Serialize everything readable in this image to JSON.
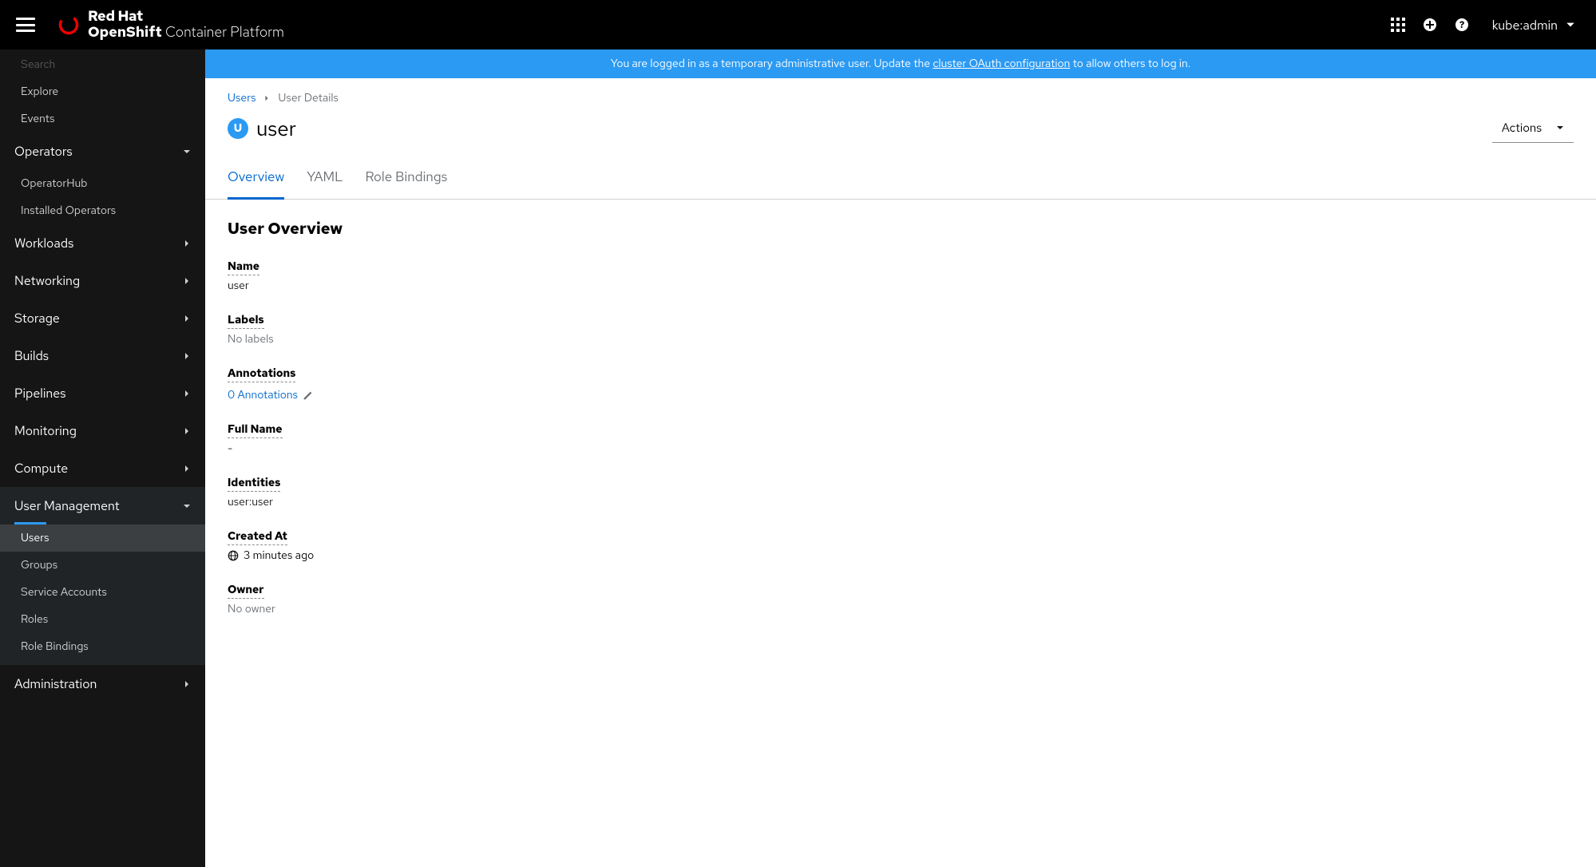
{
  "header": {
    "brand_top": "Red Hat",
    "brand_strong": "OpenShift",
    "brand_rest": " Container Platform",
    "username": "kube:admin"
  },
  "banner": {
    "prefix": "You are logged in as a temporary administrative user. Update the ",
    "link": "cluster OAuth configuration",
    "suffix": " to allow others to log in."
  },
  "sidebar": {
    "top_items": [
      "Search",
      "Explore",
      "Events"
    ],
    "operators": {
      "label": "Operators",
      "items": [
        "OperatorHub",
        "Installed Operators"
      ]
    },
    "sections": [
      "Workloads",
      "Networking",
      "Storage",
      "Builds",
      "Pipelines",
      "Monitoring",
      "Compute"
    ],
    "user_mgmt": {
      "label": "User Management",
      "items": [
        "Users",
        "Groups",
        "Service Accounts",
        "Roles",
        "Role Bindings"
      ]
    },
    "admin": "Administration"
  },
  "breadcrumb": {
    "root": "Users",
    "leaf": "User Details"
  },
  "title": {
    "badge": "U",
    "text": "user",
    "actions": "Actions"
  },
  "tabs": [
    "Overview",
    "YAML",
    "Role Bindings"
  ],
  "overview": {
    "heading": "User Overview",
    "fields": {
      "name_label": "Name",
      "name_value": "user",
      "labels_label": "Labels",
      "labels_value": "No labels",
      "annotations_label": "Annotations",
      "annotations_value": "0 Annotations",
      "fullname_label": "Full Name",
      "fullname_value": "-",
      "identities_label": "Identities",
      "identities_value": "user:user",
      "created_label": "Created At",
      "created_value": "3 minutes ago",
      "owner_label": "Owner",
      "owner_value": "No owner"
    }
  }
}
